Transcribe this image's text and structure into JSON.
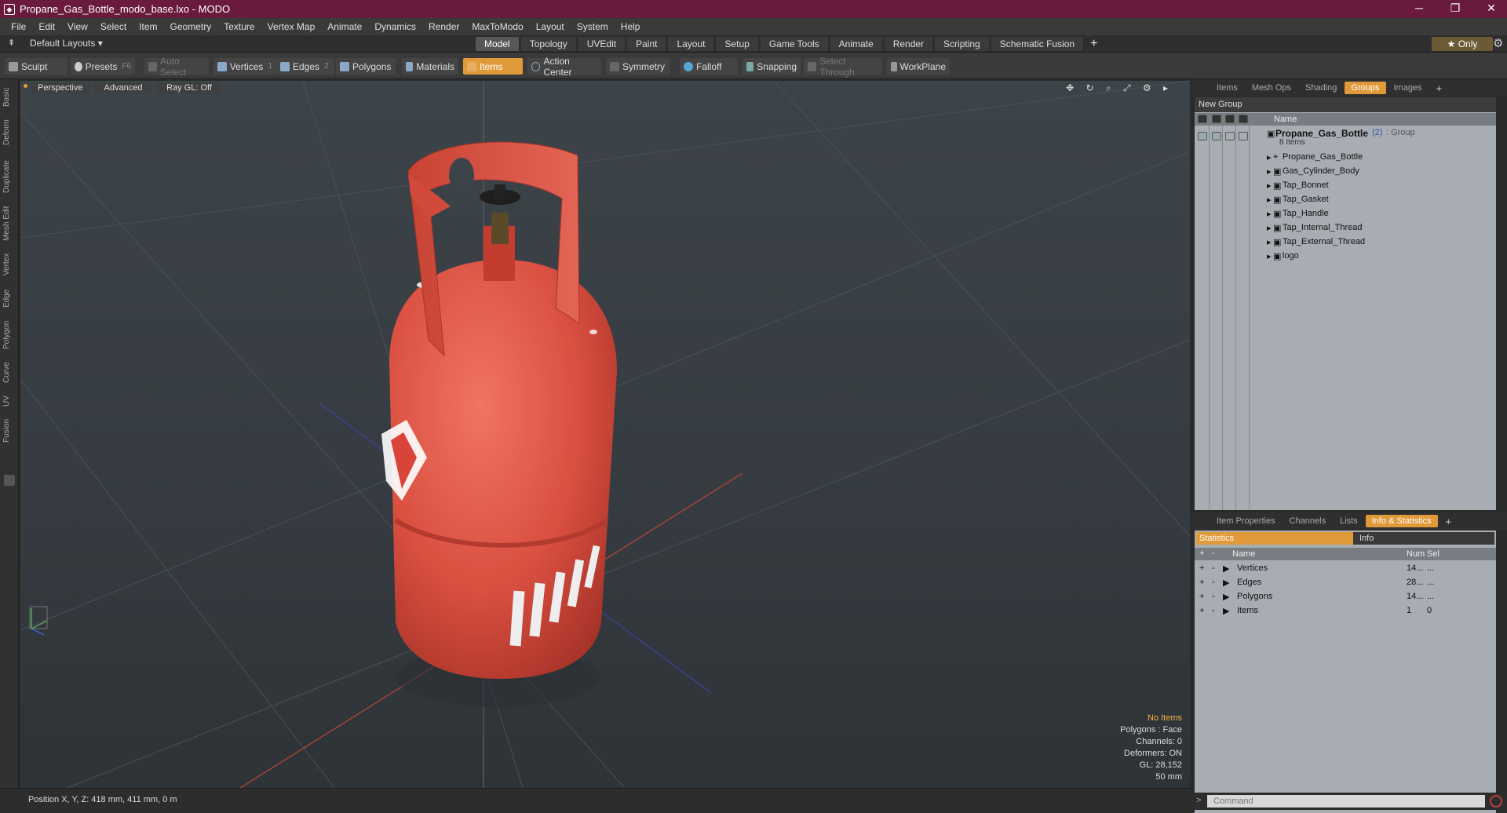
{
  "titlebar": {
    "title": "Propane_Gas_Bottle_modo_base.lxo - MODO",
    "minimize": "─",
    "maximize": "❐",
    "close": "✕"
  },
  "menu": [
    "File",
    "Edit",
    "View",
    "Select",
    "Item",
    "Geometry",
    "Texture",
    "Vertex Map",
    "Animate",
    "Dynamics",
    "Render",
    "MaxToModo",
    "Layout",
    "System",
    "Help"
  ],
  "layouts": {
    "label": "Default Layouts ▾",
    "tabs": [
      "Model",
      "Topology",
      "UVEdit",
      "Paint",
      "Layout",
      "Setup",
      "Game Tools",
      "Animate",
      "Render",
      "Scripting",
      "Schematic Fusion"
    ],
    "active_tab": "Model",
    "plus": "+",
    "only": "★ Only",
    "gear": "⚙"
  },
  "toolbar": {
    "sculpt": "Sculpt",
    "presets": "Presets",
    "presets_key": "F6",
    "auto_select": "Auto Select",
    "vertices": "Vertices",
    "vertices_n": "1",
    "edges": "Edges",
    "edges_n": "2",
    "polygons": "Polygons",
    "materials": "Materials",
    "items": "Items",
    "action_center": "Action Center",
    "symmetry": "Symmetry",
    "falloff": "Falloff",
    "snapping": "Snapping",
    "select_through": "Select Through",
    "workplane": "WorkPlane"
  },
  "left_tabs": [
    "Basic",
    "Deform",
    "Duplicate",
    "Mesh Edit",
    "Vertex",
    "Edge",
    "Polygon",
    "Curve",
    "UV",
    "Fusion"
  ],
  "viewport": {
    "perspective": "Perspective",
    "advanced": "Advanced",
    "raygl": "Ray GL: Off",
    "header_icons": "✥ ↻ ⌕ ⤢ ⚙ ▸",
    "stats": {
      "no_items": "No Items",
      "polygons": "Polygons : Face",
      "channels": "Channels: 0",
      "deformers": "Deformers: ON",
      "gl": "GL: 28,152",
      "scale": "50 mm"
    }
  },
  "status": {
    "position": "Position X, Y, Z:   418 mm, 411 mm, 0 m"
  },
  "right_tabs_top": [
    "Items",
    "Mesh Ops",
    "Shading",
    "Groups",
    "Images"
  ],
  "right_tabs_top_active": "Groups",
  "groups": {
    "new_group": "New Group",
    "name_header": "Name",
    "group_name": "Propane_Gas_Bottle",
    "group_count": "(2)",
    "group_type": ": Group",
    "group_items": "8 Items",
    "children": [
      "Propane_Gas_Bottle",
      "Gas_Cylinder_Body",
      "Tap_Bonnet",
      "Tap_Gasket",
      "Tap_Handle",
      "Tap_Internal_Thread",
      "Tap_External_Thread",
      "logo"
    ]
  },
  "right_tabs_bottom": [
    "Item Properties",
    "Channels",
    "Lists",
    "Info & Statistics"
  ],
  "right_tabs_bottom_active": "Info & Statistics",
  "statistics": {
    "tab_statistics": "Statistics",
    "tab_info": "Info",
    "headers": {
      "name": "Name",
      "num": "Num",
      "sel": "Sel"
    },
    "rows": [
      {
        "name": "Vertices",
        "num": "14...",
        "sel": "..."
      },
      {
        "name": "Edges",
        "num": "28...",
        "sel": "..."
      },
      {
        "name": "Polygons",
        "num": "14...",
        "sel": "..."
      },
      {
        "name": "Items",
        "num": "1",
        "sel": "0"
      }
    ]
  },
  "command": {
    "placeholder": "Command",
    "arrow": ">"
  }
}
